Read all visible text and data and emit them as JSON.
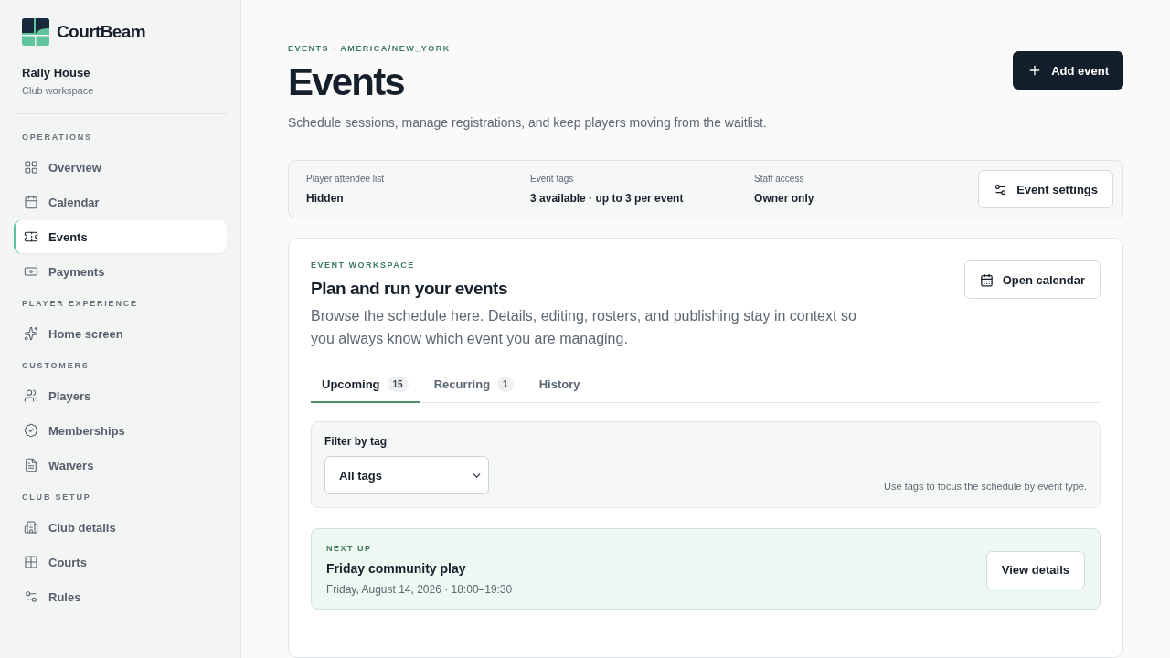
{
  "brand": {
    "name": "CourtBeam"
  },
  "club": {
    "name": "Rally House",
    "subtitle": "Club workspace"
  },
  "nav_sections": [
    {
      "heading": "OPERATIONS",
      "items": [
        {
          "label": "Overview",
          "selected": false
        },
        {
          "label": "Calendar",
          "selected": false
        },
        {
          "label": "Events",
          "selected": true
        },
        {
          "label": "Payments",
          "selected": false
        }
      ]
    },
    {
      "heading": "PLAYER EXPERIENCE",
      "items": [
        {
          "label": "Home screen",
          "selected": false
        }
      ]
    },
    {
      "heading": "CUSTOMERS",
      "items": [
        {
          "label": "Players",
          "selected": false
        },
        {
          "label": "Memberships",
          "selected": false
        },
        {
          "label": "Waivers",
          "selected": false
        }
      ]
    },
    {
      "heading": "CLUB SETUP",
      "items": [
        {
          "label": "Club details",
          "selected": false
        },
        {
          "label": "Courts",
          "selected": false
        },
        {
          "label": "Rules",
          "selected": false
        }
      ]
    }
  ],
  "header": {
    "eyebrow": "EVENTS · AMERICA/NEW_YORK",
    "title": "Events",
    "description": "Schedule sessions, manage registrations, and keep players moving from the waitlist.",
    "add_button": "Add event"
  },
  "settings_summary": {
    "items": [
      {
        "label": "Player attendee list",
        "value": "Hidden"
      },
      {
        "label": "Event tags",
        "value": "3 available · up to 3 per event"
      },
      {
        "label": "Staff access",
        "value": "Owner only"
      }
    ],
    "button": "Event settings"
  },
  "workspace": {
    "eyebrow": "EVENT WORKSPACE",
    "title": "Plan and run your events",
    "description": "Browse the schedule here. Details, editing, rosters, and publishing stay in context so you always know which event you are managing.",
    "button": "Open calendar",
    "tabs": [
      {
        "label": "Upcoming",
        "count": "15",
        "selected": true
      },
      {
        "label": "Recurring",
        "count": "1",
        "selected": false
      },
      {
        "label": "History",
        "selected": false
      }
    ],
    "filter": {
      "label": "Filter by tag",
      "value": "All tags",
      "hint": "Use tags to focus the schedule by event type."
    },
    "next_up": {
      "eyebrow": "NEXT UP",
      "title": "Friday community play",
      "when": "Friday, August 14, 2026 · 18:00–19:30",
      "button": "View details"
    }
  }
}
